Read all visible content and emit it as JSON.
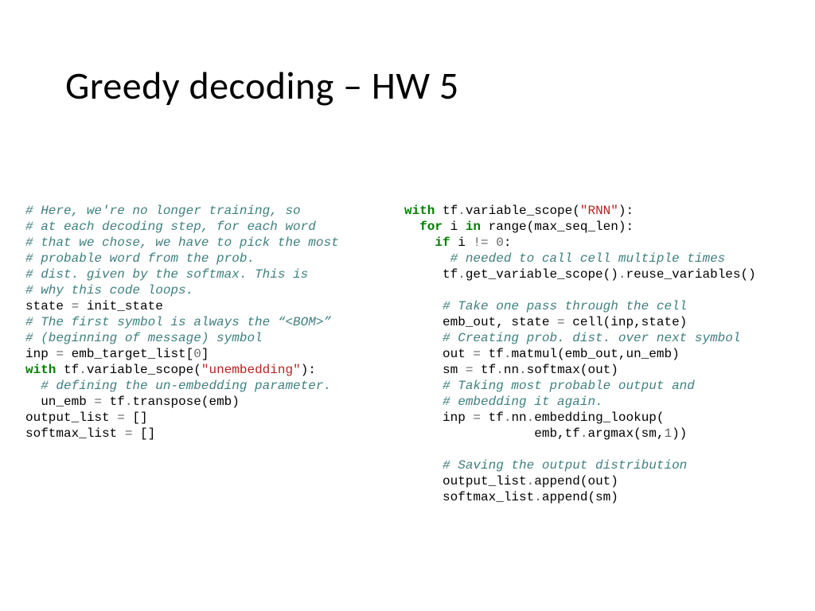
{
  "title": "Greedy decoding – HW 5",
  "left": {
    "c1": "# Here, we're no longer training, so",
    "c2": "# at each decoding step, for each word",
    "c3": "# that we chose, we have to pick the most",
    "c4": "# probable word from the prob.",
    "c5": "# dist. given by the softmax. This is",
    "c6": "# why this code loops.",
    "l7a": "state ",
    "l7b": "=",
    "l7c": " init_state",
    "c8": "# The first symbol is always the “<BOM>”",
    "c9": "# (beginning of message) symbol",
    "l10a": "inp ",
    "l10b": "=",
    "l10c": " emb_target_list[",
    "l10d": "0",
    "l10e": "]",
    "l11a": "with",
    "l11b": " tf",
    "l11c": ".",
    "l11d": "variable_scope(",
    "l11e": "\"unembedding\"",
    "l11f": "):",
    "c12": "# defining the un-embedding parameter.",
    "l13a": "  un_emb ",
    "l13b": "=",
    "l13c": " tf",
    "l13d": ".",
    "l13e": "transpose(emb)",
    "l14a": "output_list ",
    "l14b": "=",
    "l14c": " []",
    "l15a": "softmax_list ",
    "l15b": "=",
    "l15c": " []"
  },
  "right": {
    "l1a": "with",
    "l1b": " tf",
    "l1c": ".",
    "l1d": "variable_scope(",
    "l1e": "\"RNN\"",
    "l1f": "):",
    "l2a": "for",
    "l2b": " i ",
    "l2c": "in",
    "l2d": " range",
    "l2e": "(max_seq_len):",
    "l3a": "if",
    "l3b": " i ",
    "l3c": "!=",
    "l3d": " ",
    "l3e": "0",
    "l3f": ":",
    "c4": "# needed to call cell multiple times",
    "l5a": "tf",
    "l5b": ".",
    "l5c": "get_variable_scope()",
    "l5d": ".",
    "l5e": "reuse_variables()",
    "c7": "# Take one pass through the cell",
    "l8a": "emb_out, state ",
    "l8b": "=",
    "l8c": " cell(inp,state)",
    "c9": "# Creating prob. dist. over next symbol",
    "l10a": "out ",
    "l10b": "=",
    "l10c": " tf",
    "l10d": ".",
    "l10e": "matmul(emb_out,un_emb)",
    "l11a": "sm ",
    "l11b": "=",
    "l11c": " tf",
    "l11d": ".",
    "l11e": "nn",
    "l11f": ".",
    "l11g": "softmax(out)",
    "c12": "# Taking most probable output and",
    "c13": "# embedding it again.",
    "l14a": "inp ",
    "l14b": "=",
    "l14c": " tf",
    "l14d": ".",
    "l14e": "nn",
    "l14f": ".",
    "l14g": "embedding_lookup(",
    "l15a": "emb,tf",
    "l15b": ".",
    "l15c": "argmax(sm,",
    "l15d": "1",
    "l15e": "))",
    "c17": "# Saving the output distribution",
    "l18a": "output_list",
    "l18b": ".",
    "l18c": "append(out)",
    "l19a": "softmax_list",
    "l19b": ".",
    "l19c": "append(sm)"
  }
}
